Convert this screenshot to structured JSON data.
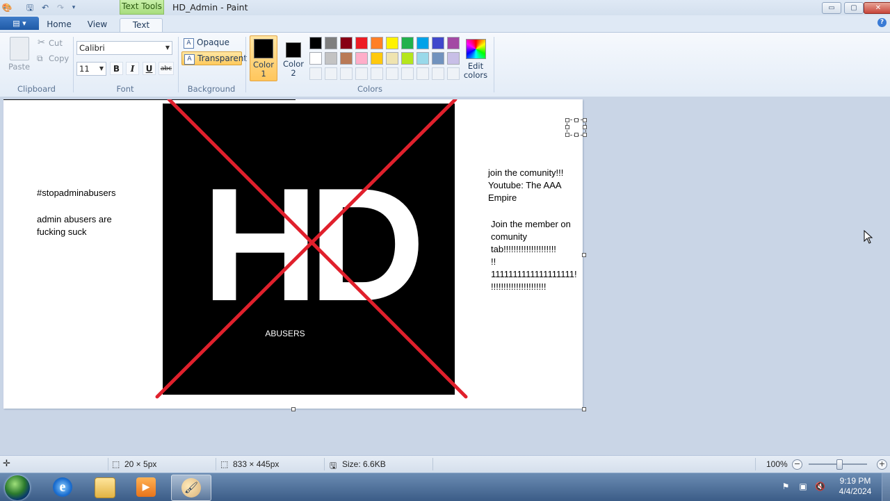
{
  "window": {
    "title": "HD_Admin - Paint",
    "contextual_tab_label": "Text Tools",
    "controls": {
      "minimize": "▭",
      "maximize": "▢",
      "close": "✕"
    }
  },
  "tabs": [
    {
      "label": "Home"
    },
    {
      "label": "View"
    },
    {
      "label": "Text"
    }
  ],
  "ribbon": {
    "clipboard": {
      "paste": "Paste",
      "cut": "Cut",
      "copy": "Copy",
      "group": "Clipboard"
    },
    "font": {
      "family": "Calibri",
      "size": "11",
      "bold": "B",
      "italic": "I",
      "underline": "U",
      "strike": "abc",
      "group": "Font"
    },
    "background": {
      "opaque": "Opaque",
      "transparent": "Transparent",
      "group": "Background"
    },
    "colors": {
      "color1_label_line1": "Color",
      "color1_label_line2": "1",
      "color2_label_line1": "Color",
      "color2_label_line2": "2",
      "color1": "#000000",
      "color2": "#000000",
      "edit_label_line1": "Edit",
      "edit_label_line2": "colors",
      "group": "Colors",
      "palette_row1": [
        "#000000",
        "#7f7f7f",
        "#880015",
        "#ed1c24",
        "#ff7f27",
        "#fff200",
        "#22b14c",
        "#00a2e8",
        "#3f48cc",
        "#a349a4"
      ],
      "palette_row2": [
        "#ffffff",
        "#c3c3c3",
        "#b97a57",
        "#ffaec9",
        "#ffc90e",
        "#efe4b0",
        "#b5e61d",
        "#99d9ea",
        "#7092be",
        "#c8bfe7"
      ]
    }
  },
  "canvas": {
    "left_text_1": "#stopadminabusers",
    "left_text_2": "admin abusers are\nfucking suck",
    "logo_text": "HD",
    "logo_caption": "ABUSERS",
    "right_text_1": "join the comunity!!!\nYoutube: The AAA\nEmpire",
    "right_text_2": "Join the member on\ncomunity\ntab!!!!!!!!!!!!!!!!!!!!!\n!!\n1111111111111111111!\n!!!!!!!!!!!!!!!!!!!!!!",
    "cross_color": "#e0202c"
  },
  "statusbar": {
    "selection_size": "20 × 5px",
    "image_size": "833 × 445px",
    "file_size": "Size: 6.6KB",
    "zoom": "100%"
  },
  "taskbar": {
    "time": "9:19 PM",
    "date": "4/4/2024"
  }
}
